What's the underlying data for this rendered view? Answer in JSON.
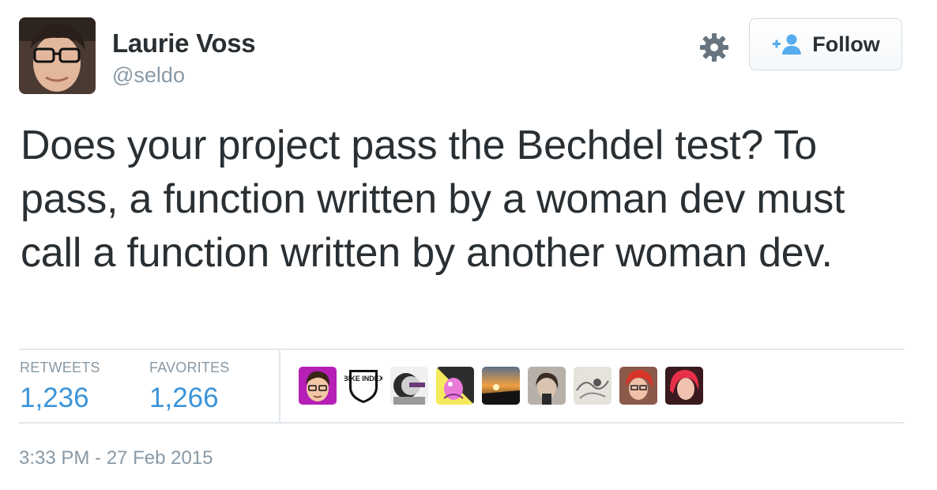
{
  "user": {
    "name": "Laurie Voss",
    "handle": "@seldo"
  },
  "actions": {
    "follow_label": "Follow",
    "follow_icon": "follow-user-icon",
    "settings_icon": "gear-icon"
  },
  "tweet": {
    "text": "Does your project pass the Bechdel test? To pass, a function written by a woman dev must call a function written by another woman dev."
  },
  "stats": {
    "retweets_label": "RETWEETS",
    "retweets_value": "1,236",
    "favorites_label": "FAVORITES",
    "favorites_value": "1,266"
  },
  "favoriters": [
    {
      "icon": "cartoon-avatar",
      "text": ""
    },
    {
      "icon": "bike-index-shield",
      "text": "BIKE INDEX"
    },
    {
      "icon": "abstract-avatar",
      "text": ""
    },
    {
      "icon": "illustration-avatar",
      "text": ""
    },
    {
      "icon": "sunset-avatar",
      "text": ""
    },
    {
      "icon": "photo-avatar",
      "text": ""
    },
    {
      "icon": "sketch-avatar",
      "text": ""
    },
    {
      "icon": "redhair-avatar",
      "text": ""
    },
    {
      "icon": "pinkhair-avatar",
      "text": ""
    }
  ],
  "meta": {
    "timestamp": "3:33 PM - 27 Feb 2015"
  },
  "colors": {
    "link_blue": "#3b94d9",
    "muted": "#8899a6",
    "text": "#292f33",
    "divider": "#e1e8ed"
  }
}
